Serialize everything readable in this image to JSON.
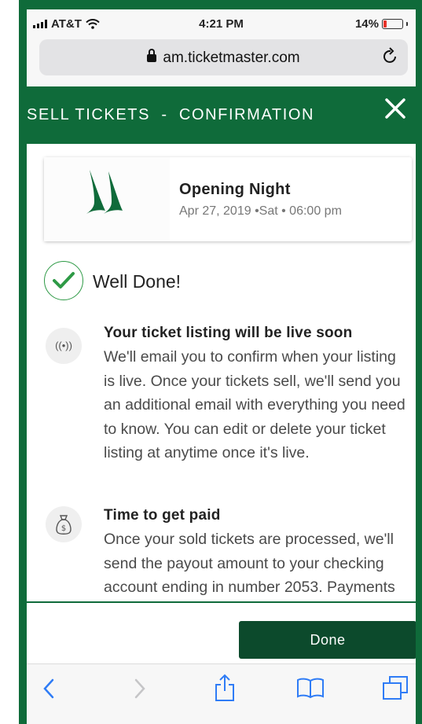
{
  "status_bar": {
    "carrier": "AT&T",
    "time": "4:21 PM",
    "battery": "14%",
    "icons": [
      "signal-icon",
      "wifi-icon",
      "battery-icon"
    ]
  },
  "browser": {
    "url": "am.ticketmaster.com",
    "icons": [
      "lock-icon",
      "reload-icon"
    ]
  },
  "header": {
    "title": "SELL TICKETS  -  CONFIRMATION",
    "close_icon": "close-icon"
  },
  "event": {
    "name": "Opening Night",
    "date": "Apr 27, 2019 •Sat • 06:00 pm",
    "logo_icon": "team-logo"
  },
  "confirmation": {
    "heading": "Well Done!",
    "icon": "check-circle-icon"
  },
  "info_sections": [
    {
      "icon": "broadcast-icon",
      "icon_text": "((•))",
      "title": "Your ticket listing will be live soon",
      "body": "We'll email you to confirm when your listing is live. Once your tickets sell, we'll send you an additional email with everything you need to know. You can edit or delete your ticket listing at anytime once it's live."
    },
    {
      "icon": "money-bag-icon",
      "title": "Time to get paid",
      "body": "Once your sold tickets are processed, we'll send the payout amount to your checking account ending in number 2053. Payments will be processed"
    }
  ],
  "footer": {
    "done_label": "Done"
  },
  "toolbar": {
    "icons": [
      "back-icon",
      "forward-icon",
      "share-icon",
      "bookmarks-icon",
      "tabs-icon"
    ]
  },
  "colors": {
    "brand_green": "#0f6b3a",
    "button_green": "#0c4a2c",
    "check_green": "#2e9a46",
    "ios_blue": "#2f7cf6"
  }
}
